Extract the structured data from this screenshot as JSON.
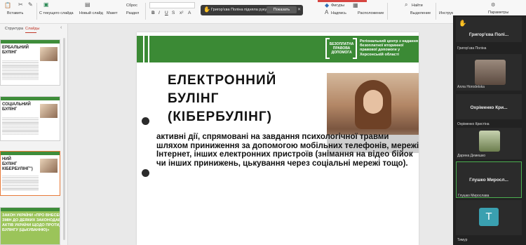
{
  "toolbar": {
    "paste": "Вставить",
    "new_slide_text": "С текущего слайда",
    "new_slide": "Новый слайд",
    "layout": "Макет",
    "reset": "Сброс",
    "section": "Раздел",
    "shapes": "Фигуры",
    "caption": "Надпись",
    "arrange": "Расположение",
    "find": "Найти",
    "select": "Выделение",
    "instruments": "Инструменты для студентов",
    "settings": "Параметры"
  },
  "notification": {
    "message": "Григор'єва Поліна підняла руку",
    "button": "Показать"
  },
  "left_panel": {
    "tab_structure": "Структура",
    "tab_slides": "Слайды",
    "thumbnails": [
      {
        "title": "ЕРБАЛЬНИЙ\nБУЛІНГ"
      },
      {
        "title": "СОЦІАЛЬНИЙ\nБУЛІНГ"
      },
      {
        "title": "НИЙ\nБУЛІНГ\nКІБЕРБУЛІНГ\")"
      },
      {
        "title": "ЗАКОН УКРАЇНИ «ПРО ВНЕСЕННЯ\nЗМІН ДО ДЕЯКИХ ЗАКОНОДАВЧИХ\nАКТІВ УКРАЇНИ ЩОДО ПРОТИДІЇ\nБУЛІНГУ (ЦЬКУВАННЮ)»"
      }
    ]
  },
  "slide": {
    "logo": "БЕЗОПЛАТНА\nПРАВОВА\nДОПОМОГА",
    "org": "Регіональний центр з надання безоплатної вторинної правової допомоги у Херсонській області",
    "title": "ЕЛЕКТРОННИЙ\nБУЛІНГ\n(КІБЕРБУЛІНГ)",
    "body": "активні дії, спрямовані на завдання психологічної травми шляхом приниження за допомогою мобільних телефонів, мережі Інтернет, інших електронних пристроїв (знімання на відео бійок чи інших принижень, цькування через соціальні мережі тощо)."
  },
  "participants": [
    {
      "name": "Григор'єва Полі...",
      "sub": "Григор'єва Поліна"
    },
    {
      "name": "Алла Horodetska"
    },
    {
      "name": "Охріменко Кри...",
      "sub": "Охріменко Кристіна"
    },
    {
      "name": "Дарина Демешко"
    },
    {
      "name": "Глушко Миросл...",
      "sub": "Глушко Мирослава"
    },
    {
      "name": "Тимур",
      "initial": "T"
    }
  ]
}
